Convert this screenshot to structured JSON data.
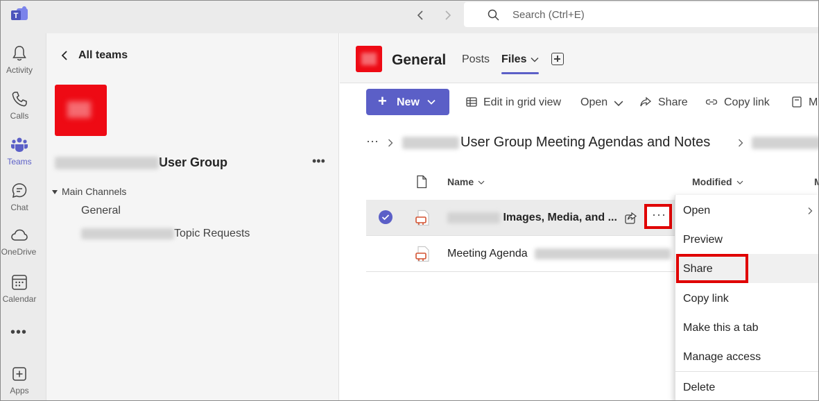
{
  "search": {
    "placeholder": "Search (Ctrl+E)"
  },
  "rail": {
    "items": [
      {
        "label": "Activity",
        "icon": "bell-icon"
      },
      {
        "label": "Calls",
        "icon": "phone-icon"
      },
      {
        "label": "Teams",
        "icon": "teams-icon"
      },
      {
        "label": "Chat",
        "icon": "chat-icon"
      },
      {
        "label": "OneDrive",
        "icon": "cloud-icon"
      },
      {
        "label": "Calendar",
        "icon": "calendar-icon"
      },
      {
        "label": "Apps",
        "icon": "apps-icon"
      }
    ],
    "more": "•••"
  },
  "panel": {
    "back_label": "All teams",
    "team_name_suffix": "User Group",
    "more": "•••",
    "channels_header": "Main Channels",
    "channels": [
      {
        "label": "General"
      },
      {
        "label_suffix": "Topic Requests"
      }
    ]
  },
  "channel": {
    "title": "General",
    "tabs": {
      "posts": "Posts",
      "files": "Files"
    }
  },
  "toolbar": {
    "new_label": "New",
    "edit_grid": "Edit in grid view",
    "open": "Open",
    "share": "Share",
    "copy_link": "Copy link",
    "truncated": "M"
  },
  "breadcrumb": {
    "dots": "···",
    "folder": "User Group Meeting Agendas and Notes"
  },
  "list": {
    "col_name": "Name",
    "col_modified": "Modified",
    "col_truncated": "M",
    "rows": [
      {
        "name_suffix": "Images, Media, and ...",
        "selected": true
      },
      {
        "name": "Meeting Agenda",
        "selected": false
      }
    ],
    "more": "···"
  },
  "menu": {
    "items": [
      {
        "label": "Open"
      },
      {
        "label": "Preview"
      },
      {
        "label": "Share"
      },
      {
        "label": "Copy link"
      },
      {
        "label": "Make this a tab"
      },
      {
        "label": "Manage access"
      },
      {
        "label": "Delete"
      }
    ]
  },
  "colors": {
    "accent": "#5b5fc7",
    "highlight": "#e00000",
    "avatar": "#ee0a14"
  }
}
